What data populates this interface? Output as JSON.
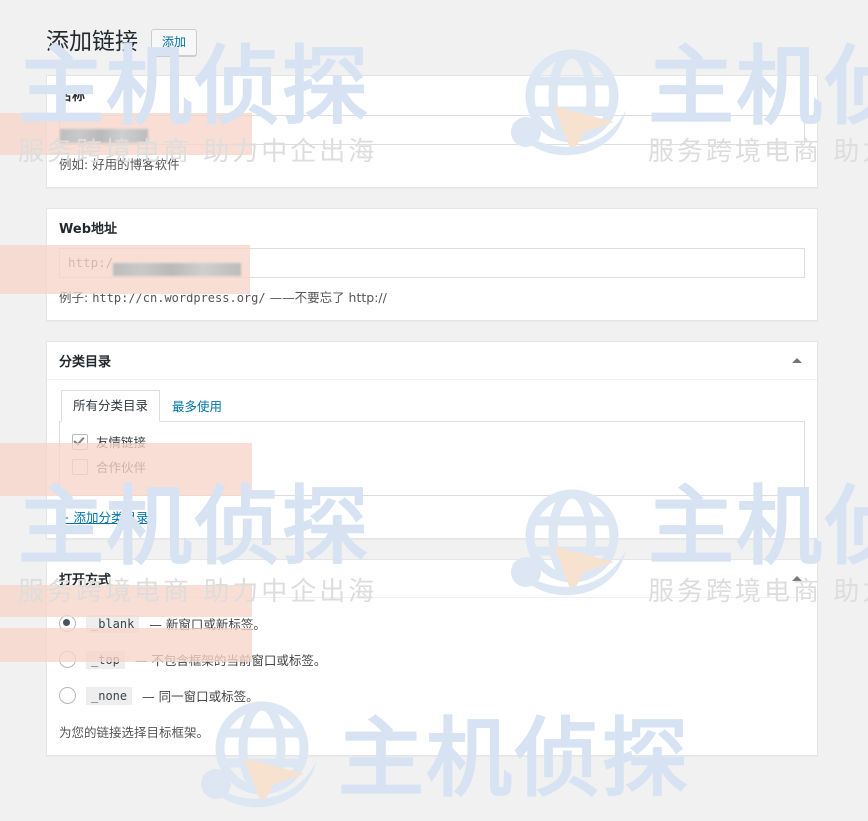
{
  "header": {
    "title": "添加链接",
    "add_button": "添加"
  },
  "name_panel": {
    "heading": "名称",
    "input_value": "",
    "input_placeholder": "",
    "hint": "例如: 好用的博客软件"
  },
  "url_panel": {
    "heading": "Web地址",
    "input_value": "http:/",
    "input_placeholder": "",
    "hint_prefix": "例子:",
    "hint_code": "http://cn.wordpress.org/",
    "hint_suffix": "——不要忘了 http://"
  },
  "category_panel": {
    "heading": "分类目录",
    "toggle_icon": "chevron-up-icon",
    "tabs": [
      {
        "label": "所有分类目录",
        "active": true
      },
      {
        "label": "最多使用",
        "active": false
      }
    ],
    "items": [
      {
        "label": "友情链接",
        "checked": true
      },
      {
        "label": "合作伙伴",
        "checked": false
      }
    ],
    "add_link": "+ 添加分类目录"
  },
  "target_panel": {
    "heading": "打开方式",
    "toggle_icon": "chevron-up-icon",
    "options": [
      {
        "code": "_blank",
        "desc": "— 新窗口或新标签。",
        "selected": true
      },
      {
        "code": "_top",
        "desc": "— 不包含框架的当前窗口或标签。",
        "selected": false
      },
      {
        "code": "_none",
        "desc": "— 同一窗口或标签。",
        "selected": false
      }
    ],
    "note": "为您的链接选择目标框架。"
  },
  "watermark": {
    "brand": "主机侦探",
    "tagline": "服务跨境电商 助力中企出海",
    "brand_color": "#d7e3f2",
    "tagline_color": "#dddddd"
  },
  "theme": {
    "page_background": "#f1f1f1",
    "panel_background": "#ffffff",
    "panel_border": "#e5e5e5",
    "link_color": "#0073aa",
    "title_color": "#23282d",
    "redaction_band_color": "#f7d5c9"
  }
}
